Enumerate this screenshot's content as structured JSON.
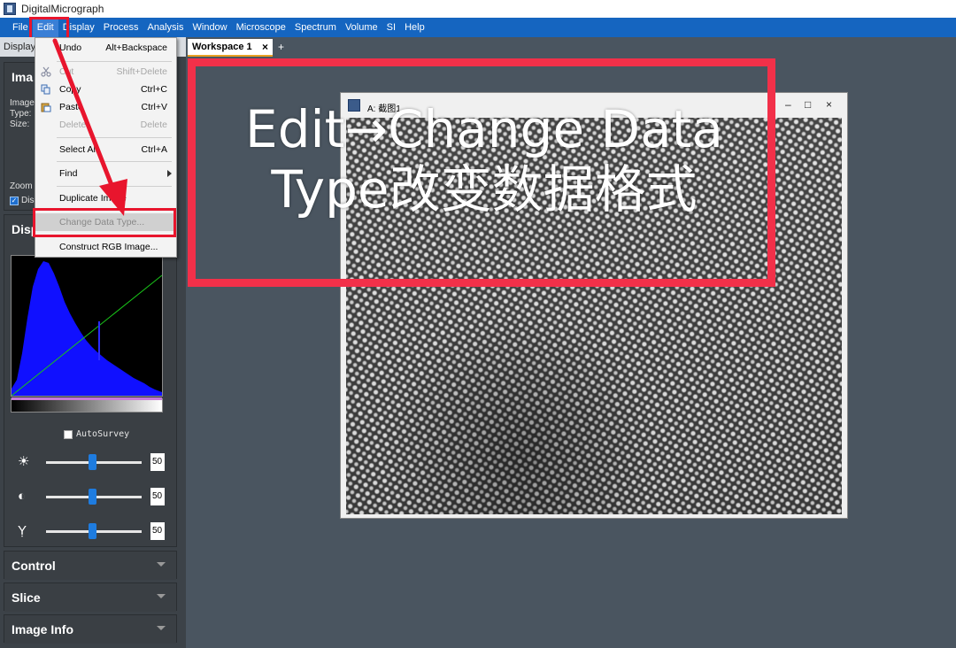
{
  "app": {
    "title": "DigitalMicrograph"
  },
  "menubar": [
    "File",
    "Edit",
    "Display",
    "Process",
    "Analysis",
    "Window",
    "Microscope",
    "Spectrum",
    "Volume",
    "SI",
    "Help"
  ],
  "toolstrip": {
    "label": "Display"
  },
  "workspace": {
    "tab_label": "Workspace 1",
    "tab_close": "×",
    "tab_add": "+"
  },
  "left_panel": {
    "image_header": "Ima",
    "info_lines": [
      "Image",
      "Type:",
      "Size:"
    ],
    "zoom_label": "Zoom",
    "disp_label": "Dis",
    "display_header": "Disp",
    "autosurvey_label": "AutoSurvey",
    "sliders": [
      {
        "icon": "☀",
        "value": "50",
        "level": 0.5
      },
      {
        "icon": "◐",
        "value": "50",
        "level": 0.5
      },
      {
        "icon": "Ỵ",
        "value": "50",
        "level": 0.5
      }
    ],
    "sections": [
      "Control",
      "Slice",
      "Image Info"
    ]
  },
  "edit_menu": {
    "items": [
      {
        "label": "Undo",
        "shortcut": "Alt+Backspace",
        "disabled": false
      },
      {
        "label": "Cut",
        "shortcut": "Shift+Delete",
        "disabled": true
      },
      {
        "label": "Copy",
        "shortcut": "Ctrl+C",
        "disabled": false
      },
      {
        "label": "Paste",
        "shortcut": "Ctrl+V",
        "disabled": false
      },
      {
        "label": "Delete",
        "shortcut": "Delete",
        "disabled": true
      },
      {
        "label": "Select All",
        "shortcut": "Ctrl+A",
        "disabled": false
      },
      {
        "label": "Find",
        "shortcut": "",
        "disabled": false
      },
      {
        "label": "Duplicate Image",
        "shortcut": "",
        "disabled": false
      },
      {
        "label": "Change Data Type...",
        "shortcut": "",
        "disabled": false
      },
      {
        "label": "Construct RGB Image...",
        "shortcut": "",
        "disabled": false
      }
    ]
  },
  "image_window": {
    "title": "A: 截图1",
    "minimize": "–",
    "maximize": "□",
    "close": "×"
  },
  "annotation": {
    "line1": "Edit→Change Data",
    "line2": "Type改变数据格式",
    "color": "#f23049"
  }
}
